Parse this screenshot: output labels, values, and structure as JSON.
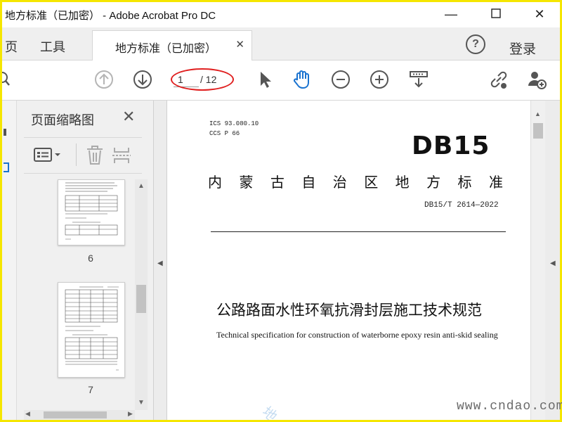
{
  "window": {
    "title": "地方标准（已加密） - Adobe Acrobat Pro DC"
  },
  "tabs": {
    "home_partial": "页",
    "tools": "工具",
    "document_tab": "地方标准（已加密）",
    "help": "?",
    "login": "登录"
  },
  "toolbar": {
    "page_current": "1",
    "page_total": "/ 12"
  },
  "thumbnails": {
    "title": "页面缩略图",
    "pages": [
      {
        "label": "6"
      },
      {
        "label": "7"
      }
    ]
  },
  "document": {
    "ics": "ICS  93.080.10",
    "ccs": "CCS  P  66",
    "standard_code": "DB15",
    "organization": [
      "内",
      "蒙",
      "古",
      "自",
      "治",
      "区",
      "地",
      "方",
      "标",
      "准"
    ],
    "standard_number": "DB15/T 2614—2022",
    "title_cn": "公路路面水性环氧抗滑封层施工技术规范",
    "title_en": "Technical specification for construction of waterborne epoxy resin anti-skid sealing"
  },
  "watermark": "www.cndao.com",
  "colors": {
    "frame": "#f5e600",
    "oval": "#e02020",
    "accent": "#1a73d0"
  }
}
